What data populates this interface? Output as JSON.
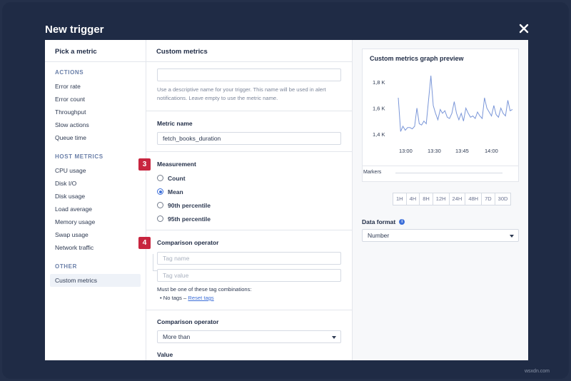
{
  "modal": {
    "title": "New trigger"
  },
  "left": {
    "header": "Pick a metric",
    "sections": [
      {
        "title": "ACTIONS",
        "items": [
          "Error rate",
          "Error count",
          "Throughput",
          "Slow actions",
          "Queue time"
        ]
      },
      {
        "title": "HOST METRICS",
        "items": [
          "CPU usage",
          "Disk I/O",
          "Disk usage",
          "Load average",
          "Memory usage",
          "Swap usage",
          "Network traffic"
        ]
      },
      {
        "title": "OTHER",
        "items": [
          "Custom metrics"
        ]
      }
    ],
    "active_item": "Custom metrics"
  },
  "middle": {
    "header": "Custom metrics",
    "name_input": {
      "value": "",
      "placeholder": ""
    },
    "name_help": "Use a descriptive name for your trigger. This name will be used in alert notifications. Leave empty to use the metric name.",
    "metric_name": {
      "label": "Metric name",
      "value": "fetch_books_duration"
    },
    "measurement": {
      "badge": "3",
      "label": "Measurement",
      "options": [
        "Count",
        "Mean",
        "90th percentile",
        "95th percentile"
      ],
      "selected": "Mean"
    },
    "tags": {
      "badge": "4",
      "label": "Comparison operator",
      "tag_name_placeholder": "Tag name",
      "tag_value_placeholder": "Tag value",
      "note": "Must be one of these tag combinations:",
      "bullet": "• No tags –",
      "reset_link": "Reset tags"
    },
    "comparison": {
      "label": "Comparison operator",
      "value": "More than"
    },
    "value_label": "Value"
  },
  "right": {
    "graph_title": "Custom metrics graph preview",
    "markers_label": "Markers",
    "ranges": [
      "1H",
      "4H",
      "8H",
      "12H",
      "24H",
      "48H",
      "7D",
      "30D"
    ],
    "data_format": {
      "label": "Data format",
      "value": "Number",
      "info_icon": "i"
    }
  },
  "chart_data": {
    "type": "line",
    "title": "Custom metrics graph preview",
    "yticks": [
      "1,8 K",
      "1,6 K",
      "1,4 K"
    ],
    "ytick_values": [
      1800,
      1600,
      1400
    ],
    "xticks": [
      "13:00",
      "13:30",
      "13:45",
      "14:00"
    ],
    "ylim": [
      1350,
      1900
    ],
    "series": [
      {
        "color": "#7a96d8",
        "values": [
          1680,
          1420,
          1460,
          1430,
          1450,
          1450,
          1440,
          1460,
          1600,
          1480,
          1470,
          1500,
          1480,
          1660,
          1850,
          1620,
          1560,
          1510,
          1590,
          1560,
          1580,
          1530,
          1520,
          1560,
          1650,
          1560,
          1510,
          1560,
          1500,
          1600,
          1560,
          1530,
          1540,
          1520,
          1570,
          1540,
          1520,
          1680,
          1600,
          1570,
          1540,
          1620,
          1550,
          1530,
          1600,
          1560,
          1540,
          1660,
          1580,
          1590
        ]
      }
    ]
  },
  "watermark": "wsxdn.com"
}
